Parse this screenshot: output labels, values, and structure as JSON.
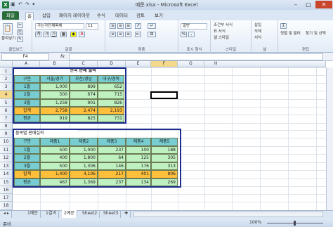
{
  "window": {
    "title": "예문.xlsx - Microsoft Excel",
    "app_icon": "X",
    "qat": "▣ ↶ ↷ ▾",
    "minimize": "–",
    "maximize": "□",
    "close": "✕"
  },
  "ribbon_tabs": {
    "file": "파일",
    "tabs": [
      "홈",
      "삽입",
      "페이지 레이아웃",
      "수식",
      "데이터",
      "검토",
      "보기"
    ]
  },
  "ribbon": {
    "clipboard": {
      "label": "클립보드",
      "paste": "붙여넣기"
    },
    "font": {
      "label": "글꼴",
      "name": "가는각진제목체",
      "size": "11",
      "bold": "가",
      "italic": "가",
      "underline": "가"
    },
    "align": {
      "label": "맞춤"
    },
    "number": {
      "label": "표시 형식",
      "format": "일반",
      "pct": "%",
      "comma": ","
    },
    "style": {
      "label": "스타일",
      "cond": "조건부 서식",
      "table": "표 서식",
      "cell": "셀 스타일"
    },
    "cells": {
      "label": "셀",
      "insert": "삽입",
      "delete": "삭제",
      "format": "서식"
    },
    "edit": {
      "label": "편집",
      "sum": "Σ",
      "sort": "정렬 및 필터",
      "find": "찾기 및 선택"
    }
  },
  "formula_bar": {
    "name_box": "F4",
    "fx": "fx",
    "value": ""
  },
  "columns": [
    "A",
    "B",
    "C",
    "D",
    "E",
    "F",
    "G",
    "H"
  ],
  "rows": [
    "1",
    "2",
    "3",
    "4",
    "5",
    "6",
    "7",
    "8",
    "9",
    "10",
    "11",
    "12",
    "13",
    "14",
    "15",
    "16",
    "17",
    "18",
    "19",
    "20"
  ],
  "table1": {
    "title": "전국 판매 실적",
    "headers": [
      "구분",
      "서울/경기",
      "부산/경남",
      "대구/경북"
    ],
    "rows": [
      [
        "1월",
        "1,000",
        "899",
        "652"
      ],
      [
        "2월",
        "500",
        "674",
        "715"
      ],
      [
        "3월",
        "1,258",
        "901",
        "826"
      ]
    ],
    "total": [
      "합계",
      "2,758",
      "2,474",
      "2,193"
    ],
    "avg": [
      "평균",
      "919",
      "825",
      "731"
    ]
  },
  "table2": {
    "title": "품목별 판매실적",
    "headers": [
      "구분",
      "제품1",
      "제품2",
      "제품3",
      "제품4",
      "제품5"
    ],
    "rows": [
      [
        "1월",
        "500",
        "1,000",
        "237",
        "100",
        "188"
      ],
      [
        "2월",
        "400",
        "1,800",
        "64",
        "125",
        "305"
      ],
      [
        "3월",
        "500",
        "1,306",
        "146",
        "176",
        "313"
      ]
    ],
    "total": [
      "합계",
      "1,400",
      "4,106",
      "217",
      "401",
      "806"
    ],
    "avg": [
      "평균",
      "467",
      "1,369",
      "237",
      "134",
      "269"
    ]
  },
  "sheets": {
    "nav": "◂ ▸",
    "tabs": [
      "1예문",
      "1결과",
      "2예문",
      "Sheet2",
      "Sheet3"
    ],
    "active": "2예문",
    "new_tab": "✚"
  },
  "status": {
    "mode": "준비",
    "zoom": "100%"
  }
}
